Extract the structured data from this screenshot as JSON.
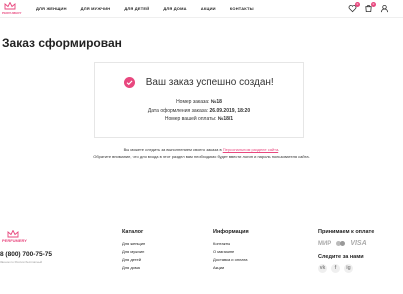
{
  "header": {
    "logo_text": "PERFUMERY",
    "nav": [
      "ДЛЯ ЖЕНЩИН",
      "ДЛЯ МУЖЧИН",
      "ДЛЯ ДЕТЕЙ",
      "ДЛЯ ДОМА",
      "АКЦИИ",
      "КОНТАКТЫ"
    ],
    "wishlist_count": "0",
    "cart_count": "0"
  },
  "page_title": "Заказ сформирован",
  "order": {
    "success_text": "Ваш заказ успешно создан!",
    "number_label": "Номер заказа:",
    "number_value": "№18",
    "date_label": "Дата оформления заказа:",
    "date_value": "26.09.2019, 18:20",
    "payment_label": "Номер вашей оплаты:",
    "payment_value": "№18/1"
  },
  "notes": {
    "line1_before": "Вы можете следить за выполнением своего заказа в",
    "line1_link": "Персональном разделе сайта",
    "line1_after": ".",
    "line2": "Обратите внимание, что для входа в этот раздел вам необходимо будет ввести логин и пароль пользователя сайта."
  },
  "footer": {
    "logo_text": "PERFUMERY",
    "phone": "8 (800) 700-75-75",
    "small_text": "Звонок по России бесплатный",
    "catalog": {
      "title": "Каталог",
      "links": [
        "Для женщин",
        "Для мужчин",
        "Для детей",
        "Для дома"
      ]
    },
    "info": {
      "title": "Информация",
      "links": [
        "Контакты",
        "О магазине",
        "Доставка и оплата",
        "Акции"
      ]
    },
    "payments": {
      "title": "Принимаем к оплате",
      "mir": "МИР",
      "visa": "VISA"
    },
    "follow_title": "Следите за нами",
    "socials": [
      "vk",
      "f",
      "ig"
    ]
  },
  "colors": {
    "accent": "#e8477e"
  }
}
